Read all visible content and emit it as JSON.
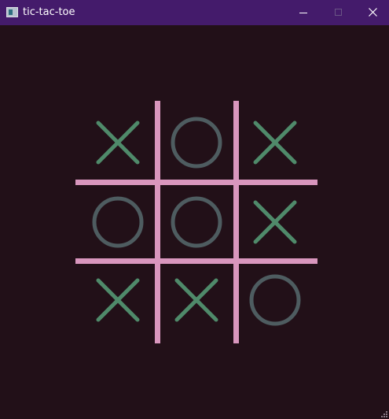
{
  "window": {
    "title": "tic-tac-toe",
    "icon": "app-window-icon",
    "controls": [
      "minimize",
      "maximize",
      "close"
    ]
  },
  "colors": {
    "titlebar": "#441b6b",
    "background": "#221018",
    "grid": "#d996bd",
    "x_mark": "#4f8a6a",
    "o_mark": "#4e5c60"
  },
  "board": {
    "cells": [
      [
        "X",
        "O",
        "X"
      ],
      [
        "O",
        "O",
        "X"
      ],
      [
        "X",
        "X",
        "O"
      ]
    ]
  }
}
